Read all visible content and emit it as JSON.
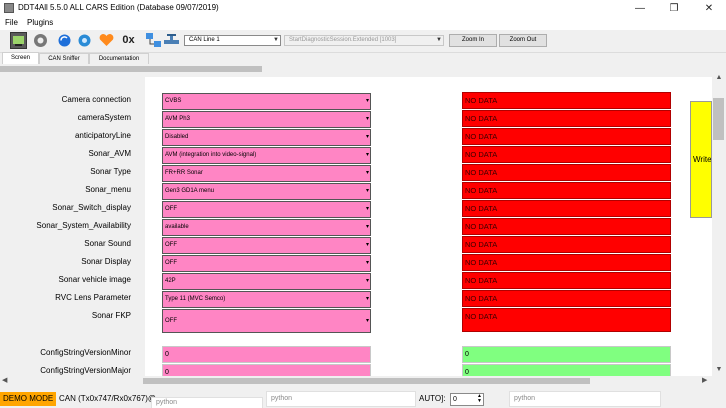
{
  "window": {
    "title": "DDT4All 5.5.0 ALL CARS Edition (Database 09/07/2019)",
    "minimize_glyph": "—",
    "maximize_glyph": "❐",
    "close_glyph": "✕"
  },
  "menu": {
    "items": [
      "File",
      "Plugins"
    ]
  },
  "toolbar": {
    "icons": [
      "ecu-icon",
      "settings-gear-icon",
      "refresh-icon",
      "sync-icon",
      "heart-icon",
      "hex-icon",
      "network-icon",
      "valve-icon"
    ],
    "hex_label": "0x",
    "can_line": "CAN Line 1",
    "session": "StartDiagnosticSession.Extended [1003]",
    "zoom_in": "Zoom In",
    "zoom_out": "Zoom Out"
  },
  "tabs": [
    "Screen",
    "CAN Sniffer",
    "Documentation"
  ],
  "params": [
    {
      "label": "Camera connection",
      "value": "CVBS",
      "data": "NO DATA"
    },
    {
      "label": "cameraSystem",
      "value": "AVM Ph3",
      "data": "NO DATA"
    },
    {
      "label": "anticipatoryLine",
      "value": "Disabled",
      "data": "NO DATA"
    },
    {
      "label": "Sonar_AVM",
      "value": "AVM (integration into video-signal)",
      "data": "NO DATA"
    },
    {
      "label": "Sonar Type",
      "value": "FR+RR Sonar",
      "data": "NO DATA"
    },
    {
      "label": "Sonar_menu",
      "value": "Gen3 GD1A menu",
      "data": "NO DATA"
    },
    {
      "label": "Sonar_Switch_display",
      "value": "OFF",
      "data": "NO DATA"
    },
    {
      "label": "Sonar_System_Availability",
      "value": "available",
      "data": "NO DATA"
    },
    {
      "label": "Sonar Sound",
      "value": "OFF",
      "data": "NO DATA"
    },
    {
      "label": "Sonar Display",
      "value": "OFF",
      "data": "NO DATA"
    },
    {
      "label": "Sonar vehicle image",
      "value": "42P",
      "data": "NO DATA"
    },
    {
      "label": "RVC Lens Parameter",
      "value": "Type 11 (MVC Semco)",
      "data": "NO DATA"
    },
    {
      "label": "Sonar FKP",
      "value": "OFF",
      "data": "NO DATA"
    }
  ],
  "config": [
    {
      "label": "ConfigStringVersionMinor",
      "value": "0",
      "data": "0"
    },
    {
      "label": "ConfigStringVersionMajor",
      "value": "0",
      "data": "0"
    }
  ],
  "write_button": "Write",
  "colors": {
    "pink": "#ff85c4",
    "red": "#ff0000",
    "green": "#80ff80",
    "yellow": "#ffff00",
    "demo": "#ffa500"
  },
  "status": {
    "demo_mode": "DEMO MODE",
    "can_info": "CAN (Tx0x747/Rx0x767)@",
    "python_placeholder": "python",
    "auto_label": "AUTO]:",
    "auto_value": "0"
  }
}
